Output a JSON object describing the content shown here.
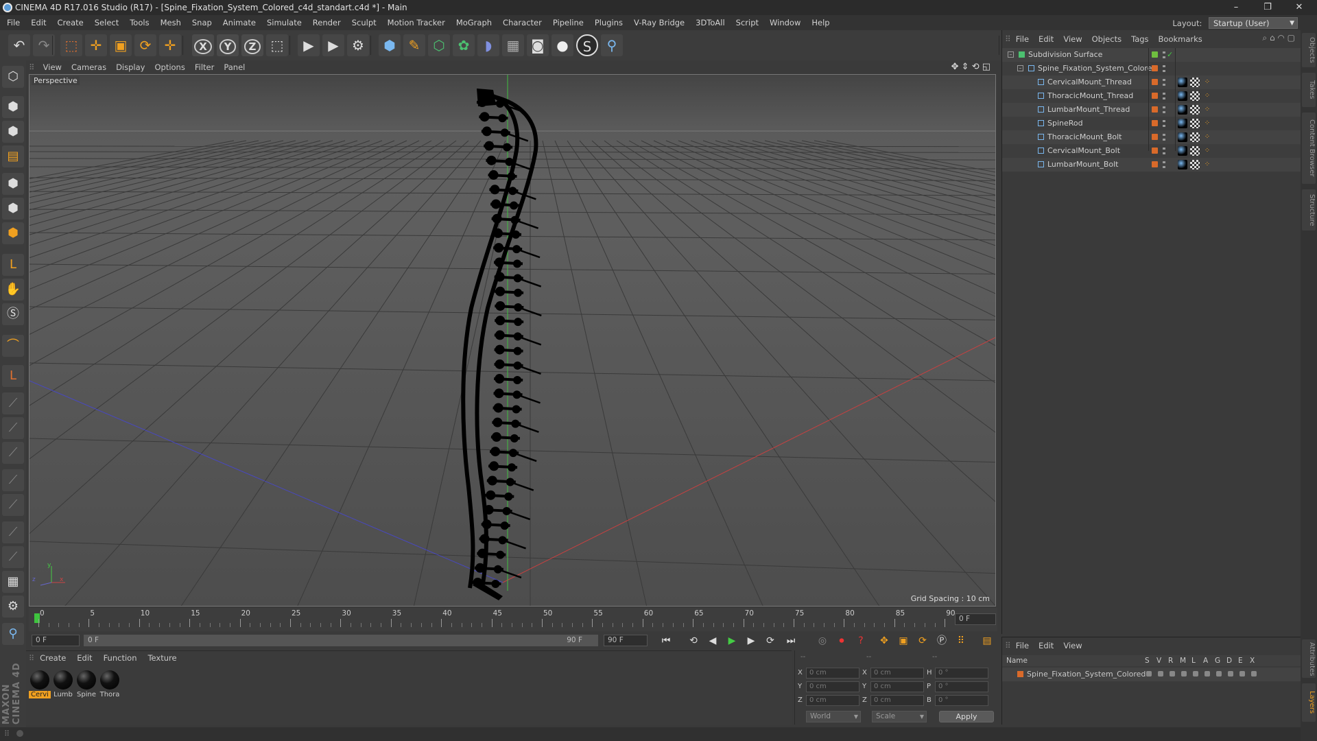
{
  "window": {
    "title": "CINEMA 4D R17.016 Studio (R17) - [Spine_Fixation_System_Colored_c4d_standart.c4d *] - Main",
    "min": "–",
    "restore": "❐",
    "close": "✕"
  },
  "menu": [
    "File",
    "Edit",
    "Create",
    "Select",
    "Tools",
    "Mesh",
    "Snap",
    "Animate",
    "Simulate",
    "Render",
    "Sculpt",
    "Motion Tracker",
    "MoGraph",
    "Character",
    "Pipeline",
    "Plugins",
    "V-Ray Bridge",
    "3DToAll",
    "Script",
    "Window",
    "Help"
  ],
  "layout": {
    "label": "Layout:",
    "value": "Startup (User)"
  },
  "toolbar_icons": [
    "undo-icon",
    "redo-icon",
    "live-select-icon",
    "move-icon",
    "scale-icon",
    "rotate-icon",
    "transform-icon",
    "x-axis-icon",
    "y-axis-icon",
    "z-axis-icon",
    "coordinate-system-icon",
    "render-view-icon",
    "render-picture-viewer-icon",
    "edit-render-settings-icon",
    "cube-icon",
    "pen-icon",
    "subdivision-icon",
    "cloner-icon",
    "deformer-icon",
    "floor-icon",
    "camera-icon",
    "light-icon",
    "sketch-icon",
    "python-icon"
  ],
  "toolbar_axis": {
    "x": "X",
    "y": "Y",
    "z": "Z"
  },
  "viewport": {
    "menu": [
      "View",
      "Cameras",
      "Display",
      "Options",
      "Filter",
      "Panel"
    ],
    "label": "Perspective",
    "grid_spacing": "Grid Spacing : 10 cm",
    "axis_y": "y",
    "axis_x": "x",
    "axis_z": "z"
  },
  "timeline": {
    "ticks": [
      "0",
      "5",
      "10",
      "15",
      "20",
      "25",
      "30",
      "35",
      "40",
      "45",
      "50",
      "55",
      "60",
      "65",
      "70",
      "75",
      "80",
      "85",
      "90"
    ],
    "current": "0 F",
    "start": "0 F",
    "slider_left": "0 F",
    "slider_right": "90 F",
    "end": "90 F"
  },
  "materials": {
    "menu": [
      "Create",
      "Edit",
      "Function",
      "Texture"
    ],
    "items": [
      {
        "label": "Cervi",
        "selected": true
      },
      {
        "label": "Lumb",
        "selected": false
      },
      {
        "label": "Spine",
        "selected": false
      },
      {
        "label": "Thora",
        "selected": false
      }
    ]
  },
  "coords": {
    "header": [
      "--",
      "--",
      "--"
    ],
    "rows": [
      {
        "a": "X",
        "av": "0 cm",
        "b": "X",
        "bv": "0 cm",
        "c": "H",
        "cv": "0 °"
      },
      {
        "a": "Y",
        "av": "0 cm",
        "b": "Y",
        "bv": "0 cm",
        "c": "P",
        "cv": "0 °"
      },
      {
        "a": "Z",
        "av": "0 cm",
        "b": "Z",
        "bv": "0 cm",
        "c": "B",
        "cv": "0 °"
      }
    ],
    "space": "World",
    "mode": "Scale",
    "apply": "Apply"
  },
  "objects": {
    "menu": [
      "File",
      "Edit",
      "View",
      "Objects",
      "Tags",
      "Bookmarks"
    ],
    "items": [
      {
        "name": "Subdivision Surface",
        "level": 0,
        "color": "#6fbf3f"
      },
      {
        "name": "Spine_Fixation_System_Colored",
        "level": 1,
        "color": "#d96a2a"
      },
      {
        "name": "CervicalMount_Thread",
        "level": 2,
        "color": "#d96a2a"
      },
      {
        "name": "ThoracicMount_Thread",
        "level": 2,
        "color": "#d96a2a"
      },
      {
        "name": "LumbarMount_Thread",
        "level": 2,
        "color": "#d96a2a"
      },
      {
        "name": "SpineRod",
        "level": 2,
        "color": "#d96a2a"
      },
      {
        "name": "ThoracicMount_Bolt",
        "level": 2,
        "color": "#d96a2a"
      },
      {
        "name": "CervicalMount_Bolt",
        "level": 2,
        "color": "#d96a2a"
      },
      {
        "name": "LumbarMount_Bolt",
        "level": 2,
        "color": "#d96a2a"
      }
    ]
  },
  "layers": {
    "menu": [
      "File",
      "Edit",
      "View"
    ],
    "columns": [
      "Name",
      "S",
      "V",
      "R",
      "M",
      "L",
      "A",
      "G",
      "D",
      "E",
      "X"
    ],
    "rows": [
      {
        "name": "Spine_Fixation_System_Colored",
        "color": "#d96a2a"
      }
    ]
  },
  "right_tabs": [
    "Objects",
    "Takes",
    "Content Browser",
    "Structure",
    "Attributes",
    "Layers"
  ],
  "brand": "MAXON CINEMA 4D",
  "colors": {
    "accent": "#f0a020",
    "x_axis": "#c84040",
    "z_axis": "#4848c0",
    "y_axis": "#40c040"
  }
}
